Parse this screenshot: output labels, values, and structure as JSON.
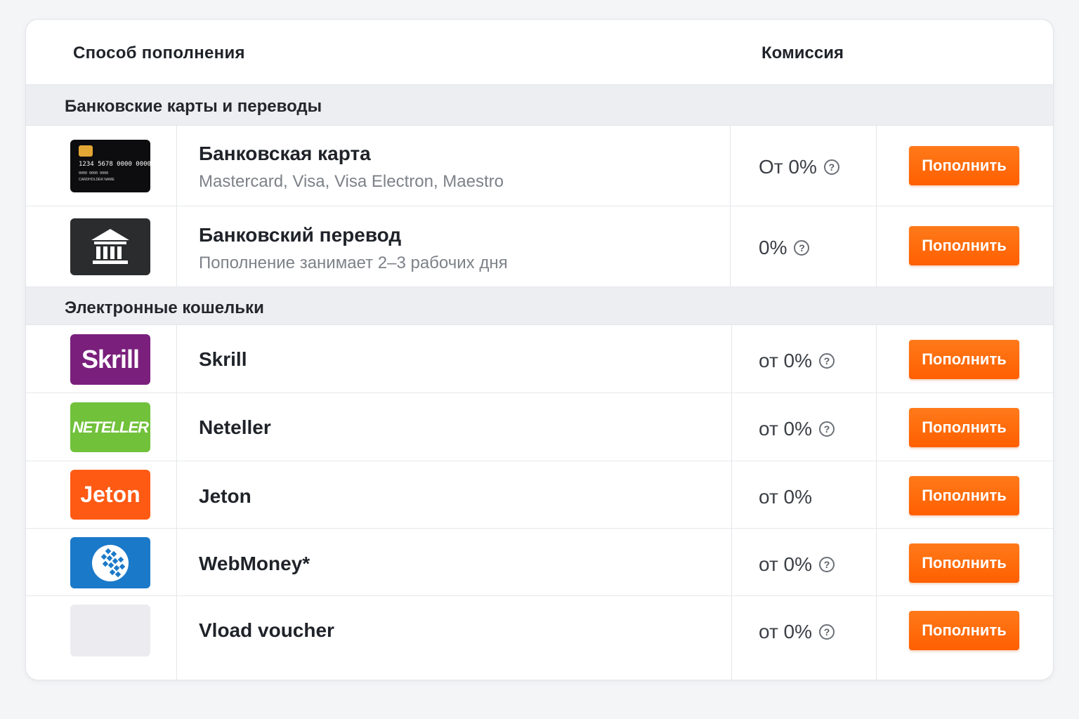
{
  "header": {
    "method_label": "Способ  пополнения",
    "fee_label": "Комиссия"
  },
  "sections": [
    {
      "title": "Банковские карты и переводы",
      "rows": [
        {
          "icon": "bank-card-icon",
          "title": "Банковская карта",
          "subtitle": "Mastercard, Visa, Visa Electron, Maestro",
          "fee": "От 0%",
          "has_help": true,
          "button": "Пополнить",
          "card": {
            "number": "1234 5678 0000 0000",
            "small": "0000  0000 0000",
            "holder": "CARDHOLDER NAME"
          }
        },
        {
          "icon": "bank-building-icon",
          "title": "Банковский перевод",
          "subtitle": "Пополнение занимает 2–3 рабочих дня",
          "fee": "0%",
          "has_help": true,
          "button": "Пополнить"
        }
      ]
    },
    {
      "title": "Электронные кошельки",
      "rows": [
        {
          "icon": "skrill-logo",
          "logo_text": "Skrill",
          "title": "Skrill",
          "fee": "от 0%",
          "has_help": true,
          "button": "Пополнить"
        },
        {
          "icon": "neteller-logo",
          "logo_text": "NETELLER",
          "title": "Neteller",
          "fee": "от 0%",
          "has_help": true,
          "button": "Пополнить"
        },
        {
          "icon": "jeton-logo",
          "logo_text": "Jeton",
          "title": "Jeton",
          "fee": "от 0%",
          "has_help": false,
          "button": "Пополнить"
        },
        {
          "icon": "webmoney-logo",
          "title": "WebMoney*",
          "fee": "от 0%",
          "has_help": true,
          "button": "Пополнить"
        },
        {
          "icon": "vload-logo",
          "title": "Vload voucher",
          "fee": "от 0%",
          "has_help": true,
          "button": "Пополнить"
        }
      ]
    }
  ],
  "help_glyph": "?",
  "colors": {
    "accent": "#ff6a0d",
    "section_bg": "#eceef1",
    "skrill": "#7a1f7c",
    "neteller": "#71c13b",
    "jeton": "#ff5a14",
    "webmoney": "#1b79c9"
  }
}
